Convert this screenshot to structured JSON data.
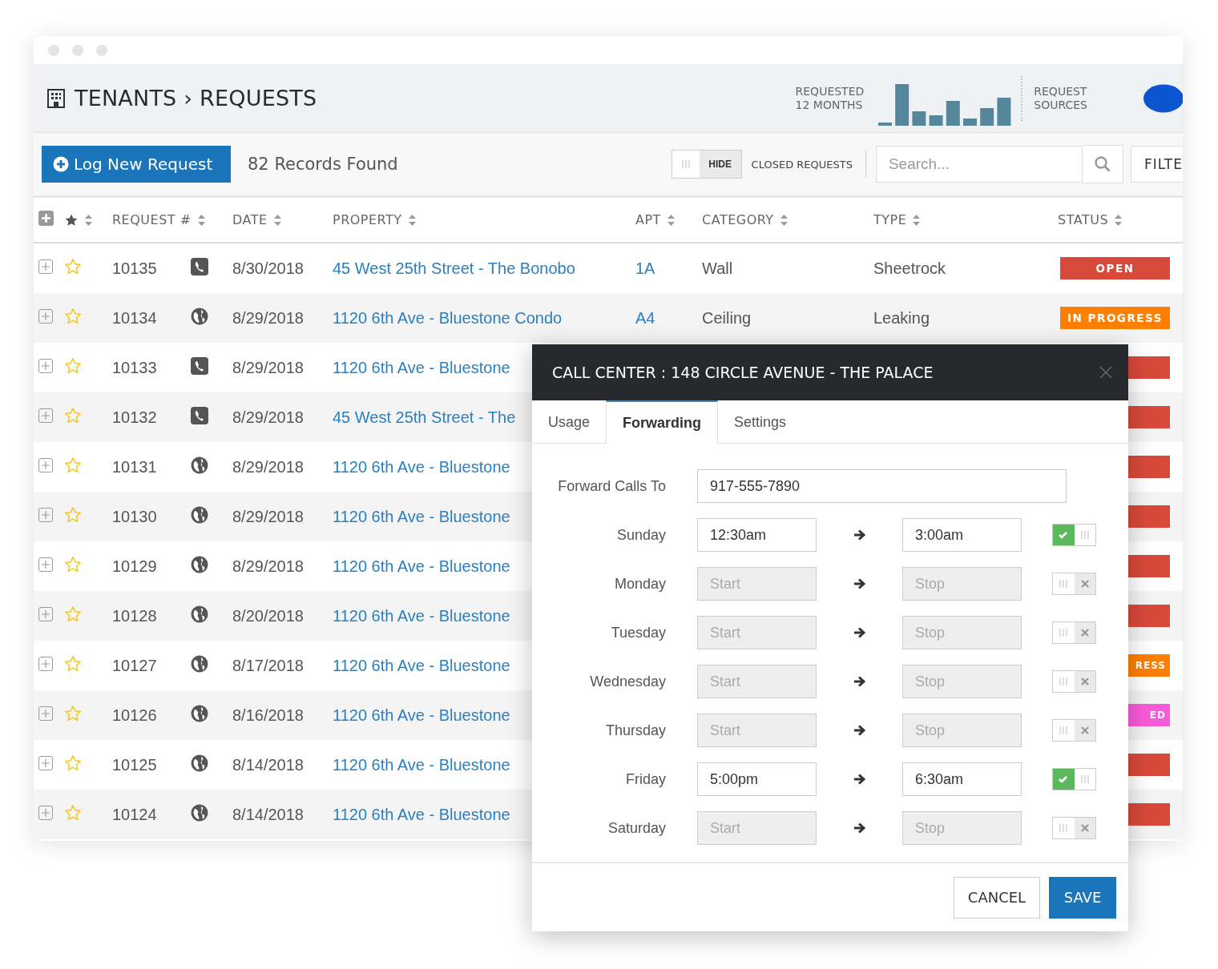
{
  "header": {
    "breadcrumb": "TENANTS › REQUESTS",
    "chart_label_1": "REQUESTED",
    "chart_label_2": "12 MONTHS",
    "sources_label_1": "REQUEST",
    "sources_label_2": "SOURCES"
  },
  "toolbar": {
    "new_button": "Log New Request",
    "records": "82 Records Found",
    "closed_toggle": {
      "label": "HIDE",
      "on": false
    },
    "closed_label": "CLOSED REQUESTS",
    "search": {
      "placeholder": "Search..."
    },
    "filter_button": "FILTE"
  },
  "table": {
    "columns": [
      "REQUEST #",
      "DATE",
      "PROPERTY",
      "APT",
      "CATEGORY",
      "TYPE",
      "STATUS"
    ],
    "rows": [
      {
        "request": "10135",
        "kind": "phone",
        "starred": false,
        "date": "8/30/2018",
        "property": "45 West 25th Street - The Bonobo",
        "apt": "1A",
        "category": "Wall",
        "type": "Sheetrock",
        "status": {
          "label": "OPEN",
          "color": "#d9493a"
        }
      },
      {
        "request": "10134",
        "kind": "web",
        "starred": false,
        "date": "8/29/2018",
        "property": "1120 6th Ave - Bluestone Condo",
        "apt": "A4",
        "category": "Ceiling",
        "type": "Leaking",
        "status": {
          "label": "IN PROGRESS",
          "color": "#ff7f00"
        }
      },
      {
        "request": "10133",
        "kind": "phone",
        "starred": false,
        "date": "8/29/2018",
        "property": "1120 6th Ave - Bluestone",
        "status": {
          "color": "#d9493a"
        }
      },
      {
        "request": "10132",
        "kind": "phone",
        "starred": false,
        "date": "8/29/2018",
        "property": "45 West 25th Street - The",
        "status": {
          "color": "#d9493a"
        }
      },
      {
        "request": "10131",
        "kind": "web",
        "starred": false,
        "date": "8/29/2018",
        "property": "1120 6th Ave - Bluestone",
        "status": {
          "color": "#d9493a"
        }
      },
      {
        "request": "10130",
        "kind": "web",
        "starred": false,
        "date": "8/29/2018",
        "property": "1120 6th Ave - Bluestone",
        "status": {
          "color": "#d9493a"
        }
      },
      {
        "request": "10129",
        "kind": "web",
        "starred": false,
        "date": "8/29/2018",
        "property": "1120 6th Ave - Bluestone",
        "status": {
          "color": "#d9493a"
        }
      },
      {
        "request": "10128",
        "kind": "web",
        "starred": false,
        "date": "8/20/2018",
        "property": "1120 6th Ave - Bluestone",
        "status": {
          "color": "#d9493a"
        }
      },
      {
        "request": "10127",
        "kind": "web",
        "starred": false,
        "date": "8/17/2018",
        "property": "1120 6th Ave - Bluestone",
        "status": {
          "label": "RESS",
          "color": "#ff7f00"
        }
      },
      {
        "request": "10126",
        "kind": "web",
        "starred": false,
        "date": "8/16/2018",
        "property": "1120 6th Ave - Bluestone",
        "status": {
          "label": "ED",
          "color": "#f95bd8"
        }
      },
      {
        "request": "10125",
        "kind": "web",
        "starred": false,
        "date": "8/14/2018",
        "property": "1120 6th Ave - Bluestone",
        "status": {
          "color": "#d9493a"
        }
      },
      {
        "request": "10124",
        "kind": "web",
        "starred": false,
        "date": "8/14/2018",
        "property": "1120 6th Ave - Bluestone",
        "status": {
          "color": "#d9493a"
        }
      }
    ]
  },
  "dialog": {
    "title": "CALL CENTER : 148 CIRCLE AVENUE - THE PALACE",
    "tabs": [
      {
        "label": "Usage",
        "selected": false
      },
      {
        "label": "Forwarding",
        "selected": true
      },
      {
        "label": "Settings",
        "selected": false
      }
    ],
    "forward_label": "Forward Calls To",
    "forward_value": "917-555-7890",
    "days": [
      {
        "day": "Sunday",
        "enabled": true,
        "start": "12:30am",
        "stop": "3:00am"
      },
      {
        "day": "Monday",
        "enabled": false,
        "start_placeholder": "Start",
        "stop_placeholder": "Stop"
      },
      {
        "day": "Tuesday",
        "enabled": false,
        "start_placeholder": "Start",
        "stop_placeholder": "Stop"
      },
      {
        "day": "Wednesday",
        "enabled": false,
        "start_placeholder": "Start",
        "stop_placeholder": "Stop"
      },
      {
        "day": "Thursday",
        "enabled": false,
        "start_placeholder": "Start",
        "stop_placeholder": "Stop"
      },
      {
        "day": "Friday",
        "enabled": true,
        "start": "5:00pm",
        "stop": "6:30am"
      },
      {
        "day": "Saturday",
        "enabled": false,
        "start_placeholder": "Start",
        "stop_placeholder": "Stop"
      }
    ],
    "buttons": {
      "cancel": "CANCEL",
      "save": "SAVE"
    }
  }
}
